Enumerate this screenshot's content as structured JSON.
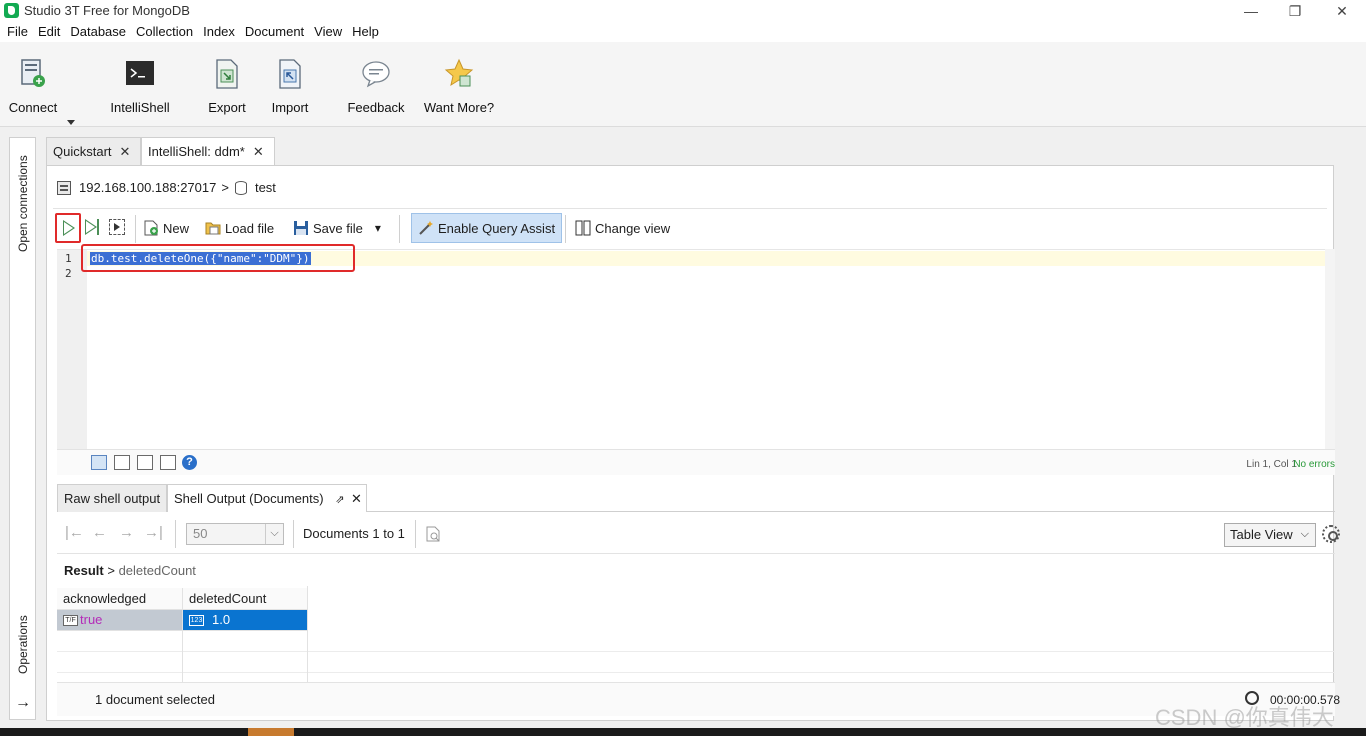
{
  "window": {
    "title": "Studio 3T Free for MongoDB",
    "minimize": "—",
    "restore": "❐",
    "close": "✕"
  },
  "menu": [
    "File",
    "Edit",
    "Database",
    "Collection",
    "Index",
    "Document",
    "View",
    "Help"
  ],
  "toolbar": {
    "connect": "Connect",
    "intellishell": "IntelliShell",
    "export": "Export",
    "import": "Import",
    "feedback": "Feedback",
    "want_more": "Want More?"
  },
  "sidebar": {
    "open_connections": "Open connections",
    "operations": "Operations",
    "expand_arrow": "→"
  },
  "tabs": [
    {
      "label": "Quickstart",
      "close": "✕"
    },
    {
      "label": "IntelliShell: ddm*",
      "close": "✕"
    }
  ],
  "breadcrumb": {
    "server": "192.168.100.188:27017",
    "separator": ">",
    "database": "test"
  },
  "editor_toolbar": {
    "new": "New",
    "load_file": "Load file",
    "save_file": "Save file",
    "save_dropdown": "▾",
    "enable_query_assist": "Enable Query Assist",
    "change_view": "Change view"
  },
  "editor": {
    "line_numbers": [
      "1",
      "2"
    ],
    "code_line_1": "db.test.deleteOne({\"name\":\"DDM\"})",
    "cursor_position": "Lin 1, Col 1",
    "error_status": "No errors",
    "help": "?"
  },
  "output": {
    "tabs": [
      {
        "label": "Raw shell output"
      },
      {
        "label": "Shell Output (Documents)",
        "pin": "⇗",
        "close": "✕"
      }
    ],
    "nav": {
      "first": "|←",
      "prev": "←",
      "next": "→",
      "last": "→|"
    },
    "page_size": "50",
    "page_size_dropdown": "⌵",
    "documents_range": "Documents 1 to 1",
    "view_mode": "Table View",
    "view_mode_dropdown": "⌵",
    "result_breadcrumb": {
      "root": "Result",
      "separator": ">",
      "field": "deletedCount"
    },
    "columns": [
      "acknowledged",
      "deletedCount"
    ],
    "rows": [
      {
        "acknowledged": "true",
        "deletedCount": "1.0"
      }
    ],
    "bool_type_badge": "T/F",
    "num_type_badge": "123",
    "selected_count": "1 document selected",
    "elapsed": "00:00:00.578"
  },
  "watermark": "CSDN @你真伟大",
  "colors": {
    "accent_green": "#13aa52",
    "highlight_red": "#e02a2a",
    "selection_blue": "#0a74d0",
    "bool_value": "#b42cb8"
  }
}
